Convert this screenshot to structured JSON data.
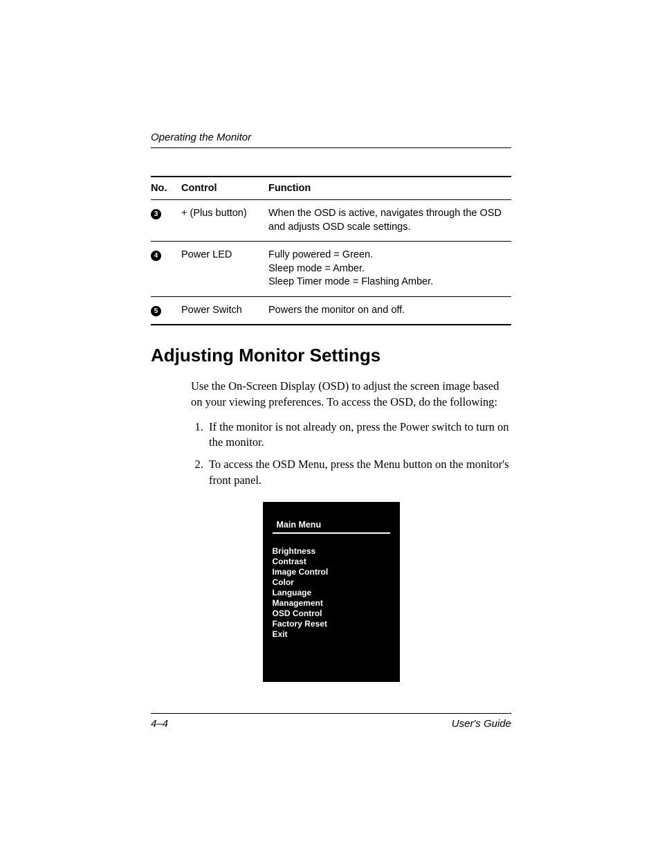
{
  "running_head": "Operating the Monitor",
  "table": {
    "headers": {
      "no": "No.",
      "control": "Control",
      "function": "Function"
    },
    "rows": [
      {
        "num": "3",
        "control": "+ (Plus button)",
        "function": "When the OSD is active, navigates through the OSD and adjusts OSD scale settings."
      },
      {
        "num": "4",
        "control": "Power LED",
        "function": "Fully powered = Green.\nSleep mode = Amber.\nSleep Timer mode = Flashing Amber."
      },
      {
        "num": "5",
        "control": "Power Switch",
        "function": "Powers the monitor on and off."
      }
    ]
  },
  "section_title": "Adjusting Monitor Settings",
  "intro": "Use the On-Screen Display (OSD) to adjust the screen image based on your viewing preferences. To access the OSD, do the following:",
  "steps": [
    "If the monitor is not already on, press the Power switch to turn on the monitor.",
    "To access the OSD Menu, press the Menu button on the monitor's front panel."
  ],
  "osd": {
    "title": "Main Menu",
    "items": [
      "Brightness",
      "Contrast",
      "Image Control",
      "Color",
      "Language",
      "Management",
      "OSD Control",
      "Factory Reset",
      "Exit"
    ]
  },
  "footer": {
    "page": "4–4",
    "doc": "User's Guide"
  }
}
